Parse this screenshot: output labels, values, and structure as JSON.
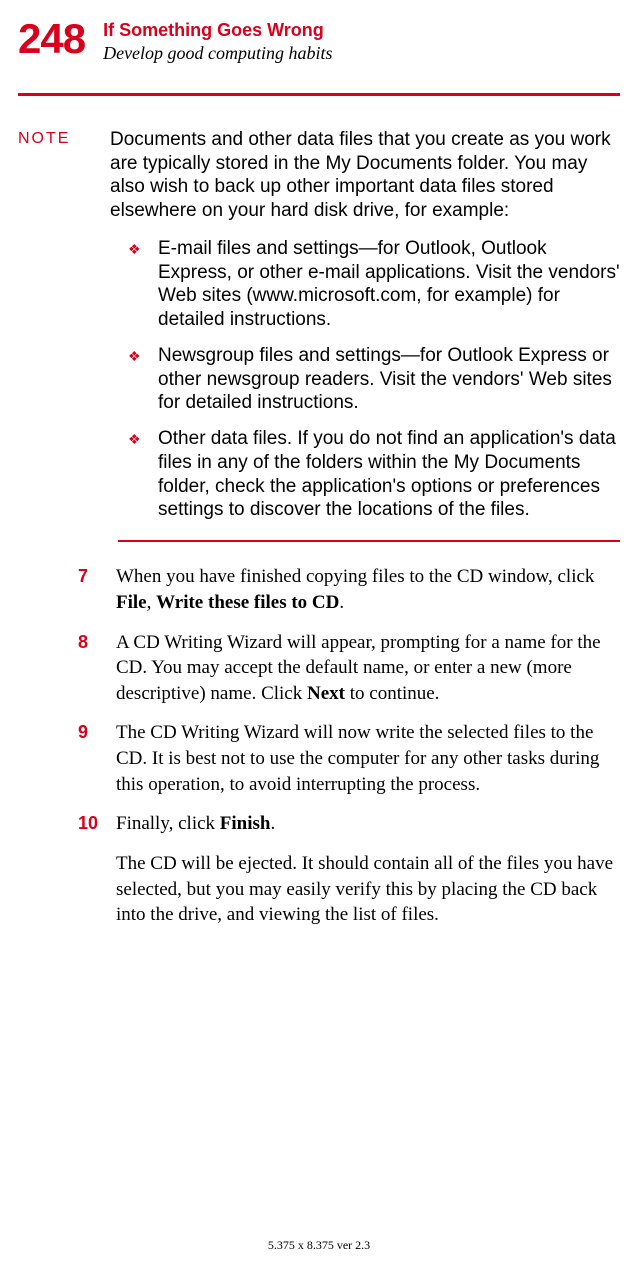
{
  "page_number": "248",
  "chapter_title": "If Something Goes Wrong",
  "section_title": "Develop good computing habits",
  "note": {
    "label": "NOTE",
    "intro": "Documents and other data files that you create as you work are typically stored in the My Documents folder. You may also wish to back up other important data files stored elsewhere on your hard disk drive, for example:",
    "items": [
      "E-mail files and settings—for Outlook, Outlook Express, or other e-mail applications. Visit the vendors' Web sites (www.microsoft.com, for example) for detailed instructions.",
      "Newsgroup files and settings—for Outlook Express or other newsgroup readers. Visit the vendors' Web sites for detailed instructions.",
      "Other data files. If you do not find an application's data files in any of the folders within the My Documents folder, check the application's options or preferences settings to discover the locations of the files."
    ]
  },
  "steps": {
    "s7": {
      "num": "7",
      "pre": "When you have finished copying files to the CD window, click ",
      "b1": "File",
      "mid": ", ",
      "b2": "Write these files to CD",
      "post": "."
    },
    "s8": {
      "num": "8",
      "pre": "A CD Writing Wizard will appear, prompting for a name for the CD. You may accept the default name, or enter a new (more descriptive) name. Click ",
      "b1": "Next",
      "post": " to continue."
    },
    "s9": {
      "num": "9",
      "text": "The CD Writing Wizard will now write the selected files to the CD. It is best not to use the computer for any other tasks during this operation, to avoid interrupting the process."
    },
    "s10": {
      "num": "10",
      "pre": "Finally, click ",
      "b1": "Finish",
      "post": "."
    }
  },
  "after_steps": "The CD will be ejected. It should contain all of the files you have selected, but you may easily verify this by placing the CD back into the drive, and viewing the list of files.",
  "footer": "5.375 x 8.375 ver 2.3"
}
